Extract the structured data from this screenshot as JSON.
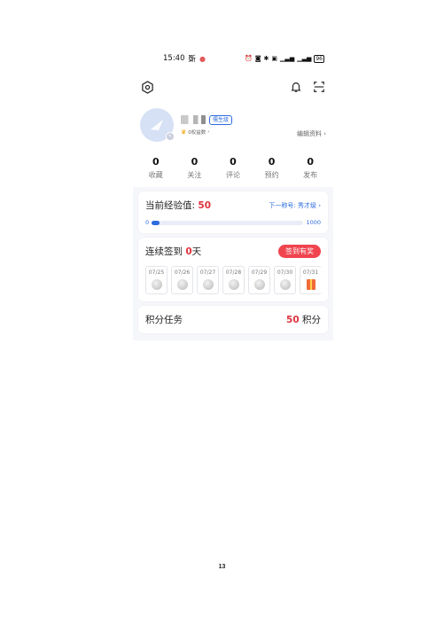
{
  "status_bar": {
    "time": "15:40",
    "carrier_icon": "斲",
    "battery": "96"
  },
  "profile": {
    "level_badge": "儒生级",
    "sub_info": "0权益数",
    "edit_label": "编辑资料"
  },
  "stats": [
    {
      "value": "0",
      "label": "收藏"
    },
    {
      "value": "0",
      "label": "关注"
    },
    {
      "value": "0",
      "label": "评论"
    },
    {
      "value": "0",
      "label": "预约"
    },
    {
      "value": "0",
      "label": "发布"
    }
  ],
  "experience": {
    "title": "当前经验值:",
    "value": "50",
    "next_level": "下一称号: 秀才级",
    "min": "0",
    "max": "1000",
    "progress": 0.05
  },
  "sign_in": {
    "title_prefix": "连续签到",
    "days": "0",
    "suffix": "天",
    "button": "签到有奖",
    "dates": [
      "07/25",
      "07/26",
      "07/27",
      "07/28",
      "07/29",
      "07/30",
      "07/31"
    ]
  },
  "tasks": {
    "title": "积分任务",
    "points": "50",
    "points_unit": "积分"
  },
  "page_number": "13",
  "icons": {
    "settings": "hexagon-gear-icon",
    "bell": "bell-icon",
    "scan": "scan-icon"
  }
}
